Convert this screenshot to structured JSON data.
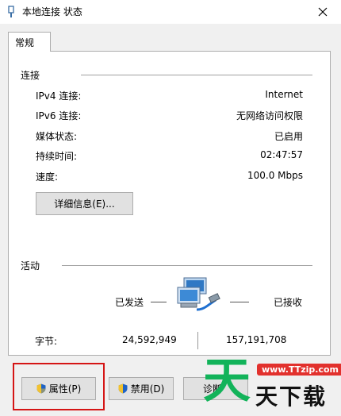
{
  "window": {
    "title": "本地连接 状态",
    "close_icon": "close-icon"
  },
  "tabs": [
    {
      "label": "常规"
    }
  ],
  "connection": {
    "group_label": "连接",
    "rows": [
      {
        "label": "IPv4 连接:",
        "value": "Internet"
      },
      {
        "label": "IPv6 连接:",
        "value": "无网络访问权限"
      },
      {
        "label": "媒体状态:",
        "value": "已启用"
      },
      {
        "label": "持续时间:",
        "value": "02:47:57"
      },
      {
        "label": "速度:",
        "value": "100.0 Mbps"
      }
    ],
    "details_button": "详细信息(E)..."
  },
  "activity": {
    "group_label": "活动",
    "sent_label": "已发送",
    "received_label": "已接收",
    "bytes_label": "字节:",
    "bytes_sent": "24,592,949",
    "bytes_received": "157,191,708",
    "icon": "network-computers-icon"
  },
  "buttons": {
    "properties": "属性(P)",
    "disable": "禁用(D)",
    "diagnose": "诊断"
  },
  "watermark": {
    "big": "天",
    "url": "www.TTzip.com",
    "sub": "天下载"
  },
  "colors": {
    "highlight": "#d51515",
    "watermark_green": "#12b35a",
    "watermark_red": "#e2312d"
  }
}
